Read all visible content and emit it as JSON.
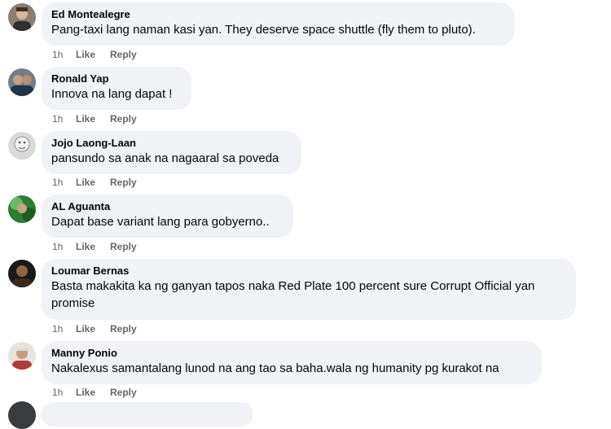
{
  "comments": [
    {
      "author": "Ed Montealegre",
      "text": "Pang-taxi lang naman kasi yan. They deserve space shuttle (fly them to pluto).",
      "time": "1h",
      "like_label": "Like",
      "reply_label": "Reply"
    },
    {
      "author": "Ronald Yap",
      "text": "Innova na lang dapat !",
      "time": "1h",
      "like_label": "Like",
      "reply_label": "Reply"
    },
    {
      "author": "Jojo Laong-Laan",
      "text": "pansundo sa anak na nagaaral sa poveda",
      "time": "1h",
      "like_label": "Like",
      "reply_label": "Reply"
    },
    {
      "author": "AL Aguanta",
      "text": "Dapat base variant lang para gobyerno..",
      "time": "1h",
      "like_label": "Like",
      "reply_label": "Reply"
    },
    {
      "author": "Loumar Bernas",
      "text": "Basta makakita ka ng ganyan tapos naka Red Plate 100 percent sure Corrupt Official yan promise",
      "time": "1h",
      "like_label": "Like",
      "reply_label": "Reply"
    },
    {
      "author": "Manny Ponio",
      "text": "Nakalexus samantalang lunod na ang tao sa baha.wala ng humanity pg kurakot na",
      "time": "1h",
      "like_label": "Like",
      "reply_label": "Reply"
    }
  ]
}
